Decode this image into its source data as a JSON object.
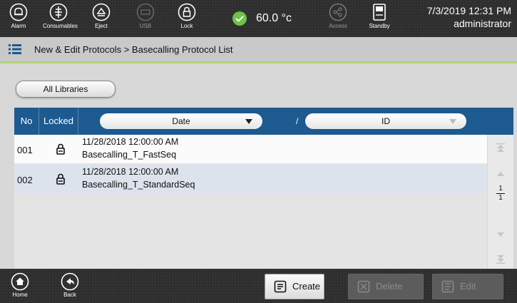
{
  "topbar": {
    "buttons": [
      {
        "label": "Alarm",
        "icon": "bell-icon"
      },
      {
        "label": "Consumables",
        "icon": "consumables-icon"
      },
      {
        "label": "Eject",
        "icon": "eject-icon"
      },
      {
        "label": "USB",
        "icon": "usb-icon"
      },
      {
        "label": "Lock",
        "icon": "lock-icon"
      },
      {
        "label": "Access",
        "icon": "share-icon"
      },
      {
        "label": "Standby",
        "icon": "standby-icon"
      }
    ],
    "temperature": "60.0 °c",
    "datetime": "7/3/2019 12:31 PM",
    "user": "administrator"
  },
  "breadcrumb": "New & Edit Protocols > Basecalling Protocol List",
  "filter_label": "All Libraries",
  "table": {
    "col_no": "No",
    "col_locked": "Locked",
    "sort_date": "Date",
    "separator": "/",
    "sort_id": "ID",
    "rows": [
      {
        "no": "001",
        "date": "11/28/2018 12:00:00 AM",
        "name": "Basecalling_T_FastSeq"
      },
      {
        "no": "002",
        "date": "11/28/2018 12:00:00 AM",
        "name": "Basecalling_T_StandardSeq"
      }
    ],
    "page_current": "1",
    "page_total": "1"
  },
  "bottombar": {
    "home": "Home",
    "back": "Back",
    "create": "Create",
    "delete": "Delete",
    "edit": "Edit"
  },
  "colors": {
    "header_blue": "#1c5a8f",
    "accent_green": "#b3d27a",
    "check_green": "#6cc24a"
  }
}
